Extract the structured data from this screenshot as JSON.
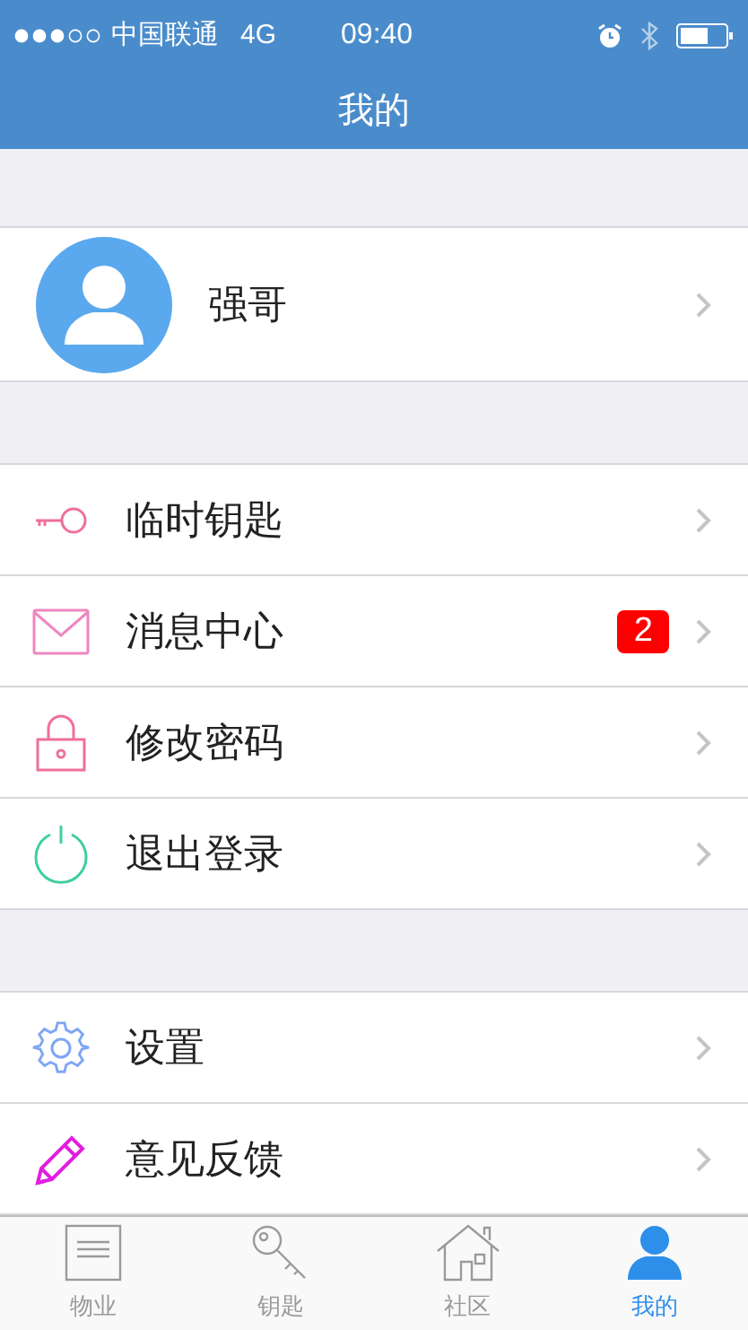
{
  "status_bar": {
    "carrier": "中国联通",
    "network": "4G",
    "time": "09:40"
  },
  "nav_bar": {
    "title": "我的"
  },
  "profile": {
    "name": "强哥"
  },
  "menu_groups": [
    [
      {
        "label": "临时钥匙"
      },
      {
        "label": "消息中心",
        "badge": "2"
      },
      {
        "label": "修改密码"
      },
      {
        "label": "退出登录"
      }
    ],
    [
      {
        "label": "设置"
      },
      {
        "label": "意见反馈"
      }
    ]
  ],
  "tab_bar": [
    {
      "label": "物业",
      "selected": false
    },
    {
      "label": "钥匙",
      "selected": false
    },
    {
      "label": "社区",
      "selected": false
    },
    {
      "label": "我的",
      "selected": true
    }
  ]
}
